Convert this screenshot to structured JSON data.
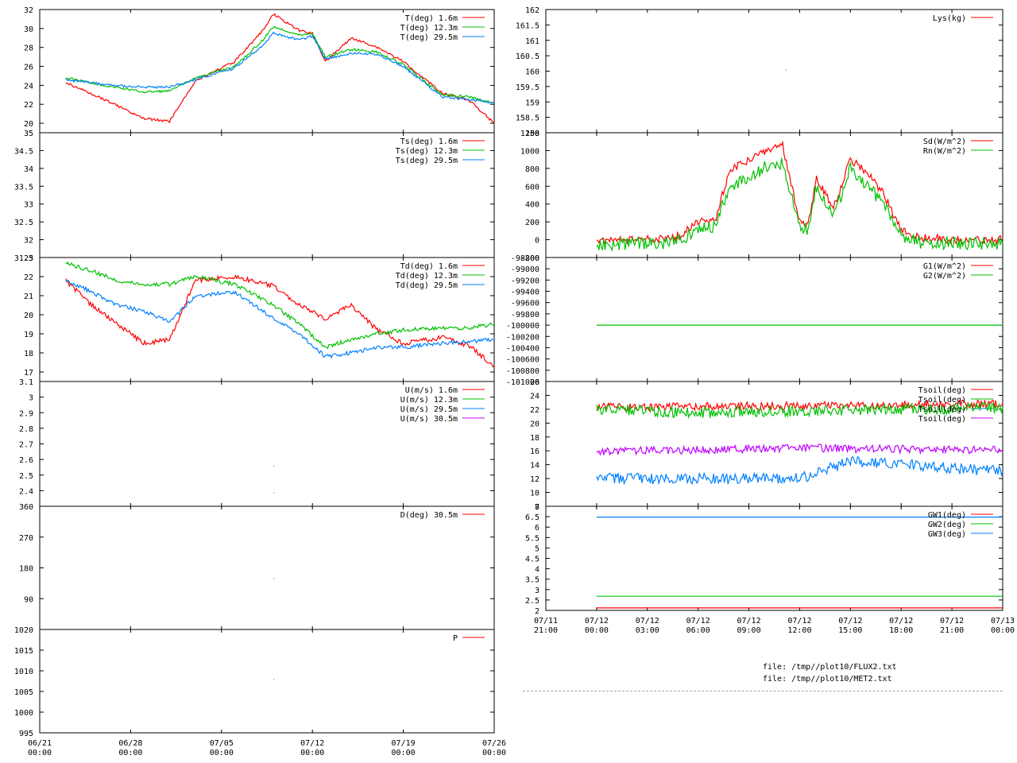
{
  "colors": {
    "red": "#ff0000",
    "green": "#00c000",
    "blue": "#0080ff",
    "purple": "#c000ff"
  },
  "left": {
    "xticks": [
      [
        "06/21",
        "00:00"
      ],
      [
        "06/28",
        "00:00"
      ],
      [
        "07/05",
        "00:00"
      ],
      [
        "07/12",
        "00:00"
      ],
      [
        "07/19",
        "00:00"
      ],
      [
        "07/26",
        "00:00"
      ]
    ],
    "panels": [
      {
        "ylabels": [
          "32",
          "30",
          "28",
          "26",
          "24",
          "22",
          "20"
        ],
        "legend": [
          {
            "label": "T(deg)  1.6m",
            "color": "red"
          },
          {
            "label": "T(deg) 12.3m",
            "color": "green"
          },
          {
            "label": "T(deg) 29.5m",
            "color": "blue"
          }
        ]
      },
      {
        "ylabels": [
          "35",
          "34.5",
          "34",
          "33.5",
          "33",
          "32.5",
          "32",
          "31.5"
        ],
        "legend": [
          {
            "label": "Ts(deg)  1.6m",
            "color": "red"
          },
          {
            "label": "Ts(deg) 12.3m",
            "color": "green"
          },
          {
            "label": "Ts(deg) 29.5m",
            "color": "blue"
          }
        ]
      },
      {
        "ylabels": [
          "23",
          "22",
          "21",
          "20",
          "19",
          "18",
          "17"
        ],
        "legend": [
          {
            "label": "Td(deg)  1.6m",
            "color": "red"
          },
          {
            "label": "Td(deg) 12.3m",
            "color": "green"
          },
          {
            "label": "Td(deg) 29.5m",
            "color": "blue"
          }
        ]
      },
      {
        "ylabels": [
          "3.1",
          "3",
          "2.9",
          "2.8",
          "2.7",
          "2.6",
          "2.5",
          "2.4"
        ],
        "legend": [
          {
            "label": "U(m/s)  1.6m",
            "color": "red"
          },
          {
            "label": "U(m/s) 12.3m",
            "color": "green"
          },
          {
            "label": "U(m/s) 29.5m",
            "color": "blue"
          },
          {
            "label": "U(m/s) 30.5m",
            "color": "purple"
          }
        ]
      },
      {
        "ylabels": [
          "360",
          "270",
          "180",
          "90"
        ],
        "legend": [
          {
            "label": "D(deg)  30.5m",
            "color": "red"
          }
        ]
      },
      {
        "ylabels": [
          "1020",
          "1015",
          "1010",
          "1005",
          "1000",
          "995"
        ],
        "legend": [
          {
            "label": "P",
            "color": "red"
          }
        ]
      }
    ]
  },
  "right": {
    "xticks": [
      [
        "07/11",
        "21:00"
      ],
      [
        "07/12",
        "00:00"
      ],
      [
        "07/12",
        "03:00"
      ],
      [
        "07/12",
        "06:00"
      ],
      [
        "07/12",
        "09:00"
      ],
      [
        "07/12",
        "12:00"
      ],
      [
        "07/12",
        "15:00"
      ],
      [
        "07/12",
        "18:00"
      ],
      [
        "07/12",
        "21:00"
      ],
      [
        "07/13",
        "00:00"
      ]
    ],
    "panels": [
      {
        "ylabels": [
          "162",
          "161.5",
          "161",
          "160.5",
          "160",
          "159.5",
          "159",
          "158.5",
          "158"
        ],
        "legend": [
          {
            "label": "Lys(kg)",
            "color": "red"
          }
        ]
      },
      {
        "ylabels": [
          "1200",
          "1000",
          "800",
          "600",
          "400",
          "200",
          "0",
          "-200"
        ],
        "legend": [
          {
            "label": "Sd(W/m^2)",
            "color": "red"
          },
          {
            "label": "Rn(W/m^2)",
            "color": "green"
          }
        ]
      },
      {
        "ylabels": [
          "-101000",
          "-100800",
          "-100600",
          "-100400",
          "-100200",
          "-100000",
          "-99800",
          "-99600",
          "-99400",
          "-99200",
          "-99000",
          "-98800"
        ],
        "legend": [
          {
            "label": "G1(W/m^2)",
            "color": "red"
          },
          {
            "label": "G2(W/m^2)",
            "color": "green"
          }
        ]
      },
      {
        "ylabels": [
          "26",
          "24",
          "22",
          "20",
          "18",
          "16",
          "14",
          "12",
          "10",
          "8"
        ],
        "legend": [
          {
            "label": "Tsoil(deg)",
            "color": "red"
          },
          {
            "label": "Tsoil(deg)",
            "color": "green"
          },
          {
            "label": "Tsoil(deg)",
            "color": "blue"
          },
          {
            "label": "Tsoil(deg)",
            "color": "purple"
          }
        ]
      },
      {
        "ylabels": [
          "7",
          "6.5",
          "6",
          "5.5",
          "5",
          "4.5",
          "4",
          "3.5",
          "3",
          "2.5",
          "2"
        ],
        "legend": [
          {
            "label": "GW1(deg)",
            "color": "red"
          },
          {
            "label": "GW2(deg)",
            "color": "green"
          },
          {
            "label": "GW3(deg)",
            "color": "blue"
          }
        ]
      }
    ]
  },
  "footer": {
    "file1": "file: /tmp//plot10/FLUX2.txt",
    "file2": "file: /tmp//plot10/MET2.txt"
  },
  "chart_data": [
    {
      "type": "line",
      "x_range": [
        "06/21 00:00",
        "07/26 00:00"
      ],
      "ylim": [
        19,
        32
      ],
      "series": [
        {
          "name": "T(deg)  1.6m",
          "color": "red",
          "x": [
            "06/23",
            "06/26",
            "06/29",
            "07/01",
            "07/03",
            "07/06",
            "07/08",
            "07/09",
            "07/11",
            "07/12",
            "07/13",
            "07/15",
            "07/17",
            "07/19",
            "07/22",
            "07/24",
            "07/26"
          ],
          "values": [
            24.3,
            22.5,
            20.5,
            20.2,
            24.5,
            26.5,
            29.5,
            31.5,
            29.8,
            29.5,
            26.5,
            29.0,
            28.0,
            26.5,
            23.2,
            22.5,
            20.0
          ]
        },
        {
          "name": "T(deg) 12.3m",
          "color": "green",
          "x": [
            "06/23",
            "06/26",
            "06/29",
            "07/01",
            "07/03",
            "07/06",
            "07/08",
            "07/09",
            "07/11",
            "07/12",
            "07/13",
            "07/15",
            "07/17",
            "07/19",
            "07/22",
            "07/24",
            "07/26"
          ],
          "values": [
            24.8,
            24.0,
            23.3,
            23.4,
            24.8,
            26.0,
            28.5,
            30.2,
            29.3,
            29.5,
            27.0,
            27.8,
            27.5,
            26.2,
            23.0,
            22.8,
            22.1
          ]
        },
        {
          "name": "T(deg) 29.5m",
          "color": "blue",
          "x": [
            "06/23",
            "06/26",
            "06/29",
            "07/01",
            "07/03",
            "07/06",
            "07/08",
            "07/09",
            "07/11",
            "07/12",
            "07/13",
            "07/15",
            "07/17",
            "07/19",
            "07/22",
            "07/24",
            "07/26"
          ],
          "values": [
            24.6,
            24.1,
            23.8,
            23.8,
            24.6,
            25.8,
            28.0,
            29.5,
            28.8,
            29.2,
            26.8,
            27.4,
            27.3,
            26.0,
            22.8,
            22.5,
            22.1
          ]
        }
      ]
    },
    {
      "type": "line",
      "x_range": [
        "06/21 00:00",
        "07/26 00:00"
      ],
      "ylim": [
        31.5,
        35
      ],
      "series": []
    },
    {
      "type": "line",
      "x_range": [
        "06/21 00:00",
        "07/26 00:00"
      ],
      "ylim": [
        16.5,
        23
      ],
      "series": [
        {
          "name": "Td(deg)  1.6m",
          "color": "red",
          "x": [
            "06/23",
            "06/25",
            "06/27",
            "06/29",
            "07/01",
            "07/03",
            "07/06",
            "07/09",
            "07/11",
            "07/13",
            "07/15",
            "07/17",
            "07/19",
            "07/22",
            "07/24",
            "07/26"
          ],
          "values": [
            21.8,
            20.5,
            19.5,
            18.5,
            18.7,
            21.8,
            22.0,
            21.5,
            20.5,
            19.8,
            20.5,
            19.2,
            18.5,
            18.8,
            18.4,
            17.3
          ]
        },
        {
          "name": "Td(deg) 12.3m",
          "color": "green",
          "x": [
            "06/23",
            "06/25",
            "06/27",
            "06/29",
            "07/01",
            "07/03",
            "07/06",
            "07/09",
            "07/11",
            "07/13",
            "07/15",
            "07/17",
            "07/19",
            "07/22",
            "07/24",
            "07/26"
          ],
          "values": [
            22.7,
            22.3,
            21.8,
            21.6,
            21.6,
            22.0,
            21.6,
            20.5,
            19.5,
            18.3,
            18.7,
            19.0,
            19.2,
            19.3,
            19.3,
            19.5
          ]
        },
        {
          "name": "Td(deg) 29.5m",
          "color": "blue",
          "x": [
            "06/23",
            "06/25",
            "06/27",
            "06/29",
            "07/01",
            "07/03",
            "07/06",
            "07/09",
            "07/11",
            "07/13",
            "07/15",
            "07/17",
            "07/19",
            "07/22",
            "07/24",
            "07/26"
          ],
          "values": [
            21.8,
            21.2,
            20.5,
            20.2,
            19.6,
            21.0,
            21.2,
            19.8,
            19.0,
            17.8,
            18.0,
            18.3,
            18.3,
            18.5,
            18.6,
            18.7
          ]
        }
      ]
    },
    {
      "type": "scatter",
      "x_range": [
        "06/21 00:00",
        "07/26 00:00"
      ],
      "ylim": [
        2.3,
        3.1
      ],
      "series": [
        {
          "name": "U(m/s)  1.6m",
          "color": "red",
          "x": [
            "07/09",
            "07/09"
          ],
          "values": [
            2.56,
            2.39
          ]
        }
      ]
    },
    {
      "type": "scatter",
      "x_range": [
        "06/21 00:00",
        "07/26 00:00"
      ],
      "ylim": [
        0,
        360
      ],
      "series": [
        {
          "name": "D(deg)  30.5m",
          "color": "red",
          "x": [
            "07/09"
          ],
          "values": [
            150
          ]
        }
      ]
    },
    {
      "type": "scatter",
      "x_range": [
        "06/21 00:00",
        "07/26 00:00"
      ],
      "ylim": [
        995,
        1020
      ],
      "series": [
        {
          "name": "P",
          "color": "red",
          "x": [
            "07/09"
          ],
          "values": [
            1008
          ]
        }
      ]
    },
    {
      "type": "scatter",
      "x_range": [
        "07/11 21:00",
        "07/13 00:00"
      ],
      "ylim": [
        158,
        162
      ],
      "series": [
        {
          "name": "Lys(kg)",
          "color": "red",
          "x": [
            "07/12 11:10"
          ],
          "values": [
            160.05
          ]
        }
      ]
    },
    {
      "type": "line",
      "x_range": [
        "07/11 21:00",
        "07/13 00:00"
      ],
      "ylim": [
        -200,
        1200
      ],
      "series": [
        {
          "name": "Sd(W/m^2)",
          "color": "red",
          "x": [
            "07/12 00:00",
            "07/12 04:00",
            "07/12 05:00",
            "07/12 06:00",
            "07/12 07:00",
            "07/12 07:30",
            "07/12 08:00",
            "07/12 09:00",
            "07/12 10:00",
            "07/12 11:00",
            "07/12 12:00",
            "07/12 12:30",
            "07/12 13:00",
            "07/12 14:00",
            "07/12 15:00",
            "07/12 16:00",
            "07/12 17:00",
            "07/12 18:00",
            "07/12 19:00",
            "07/12 21:00",
            "07/13 00:00"
          ],
          "values": [
            0,
            5,
            50,
            200,
            200,
            550,
            800,
            900,
            1000,
            1050,
            200,
            180,
            700,
            350,
            900,
            750,
            500,
            100,
            30,
            0,
            0
          ]
        },
        {
          "name": "Rn(W/m^2)",
          "color": "green",
          "x": [
            "07/12 00:00",
            "07/12 04:00",
            "07/12 05:00",
            "07/12 06:00",
            "07/12 07:00",
            "07/12 07:30",
            "07/12 08:00",
            "07/12 09:00",
            "07/12 10:00",
            "07/12 11:00",
            "07/12 12:00",
            "07/12 12:30",
            "07/12 13:00",
            "07/12 14:00",
            "07/12 15:00",
            "07/12 16:00",
            "07/12 17:00",
            "07/12 18:00",
            "07/12 19:00",
            "07/12 21:00",
            "07/13 00:00"
          ],
          "values": [
            -50,
            -40,
            -5,
            120,
            150,
            420,
            600,
            700,
            820,
            850,
            150,
            120,
            600,
            250,
            800,
            600,
            400,
            50,
            -30,
            -40,
            -40
          ]
        }
      ]
    },
    {
      "type": "line",
      "x_range": [
        "07/11 21:00",
        "07/13 00:00"
      ],
      "ylim": [
        -101000,
        -98800
      ],
      "series": [
        {
          "name": "G2(W/m^2)",
          "color": "green",
          "x": [
            "07/12 00:00",
            "07/13 00:00"
          ],
          "values": [
            -100000,
            -100000
          ]
        }
      ]
    },
    {
      "type": "line",
      "x_range": [
        "07/11 21:00",
        "07/13 00:00"
      ],
      "ylim": [
        8,
        26
      ],
      "series": [
        {
          "name": "Tsoil(deg)",
          "color": "red",
          "x": [
            "07/12 00:00",
            "07/12 12:00",
            "07/13 00:00"
          ],
          "values": [
            22.3,
            22.5,
            22.8
          ]
        },
        {
          "name": "Tsoil(deg)",
          "color": "green",
          "x": [
            "07/12 00:00",
            "07/12 06:00",
            "07/12 12:00",
            "07/12 18:00",
            "07/13 00:00"
          ],
          "values": [
            22.0,
            21.5,
            21.8,
            22.0,
            22.2
          ]
        },
        {
          "name": "Tsoil(deg)",
          "color": "blue",
          "x": [
            "07/12 00:00",
            "07/12 12:00",
            "07/12 15:00",
            "07/13 00:00"
          ],
          "values": [
            12.0,
            12.0,
            14.5,
            13.0
          ]
        },
        {
          "name": "Tsoil(deg)",
          "color": "purple",
          "x": [
            "07/12 00:00",
            "07/12 12:00",
            "07/13 00:00"
          ],
          "values": [
            15.9,
            16.4,
            16.1
          ]
        }
      ]
    },
    {
      "type": "line",
      "x_range": [
        "07/11 21:00",
        "07/13 00:00"
      ],
      "ylim": [
        2,
        7
      ],
      "series": [
        {
          "name": "GW1(deg)",
          "color": "red",
          "x": [
            "07/12 00:00",
            "07/13 00:00"
          ],
          "values": [
            2.12,
            2.12
          ]
        },
        {
          "name": "GW2(deg)",
          "color": "green",
          "x": [
            "07/12 00:00",
            "07/13 00:00"
          ],
          "values": [
            2.68,
            2.68
          ]
        },
        {
          "name": "GW3(deg)",
          "color": "blue",
          "x": [
            "07/12 00:00",
            "07/13 00:00"
          ],
          "values": [
            6.48,
            6.48
          ]
        }
      ]
    }
  ]
}
